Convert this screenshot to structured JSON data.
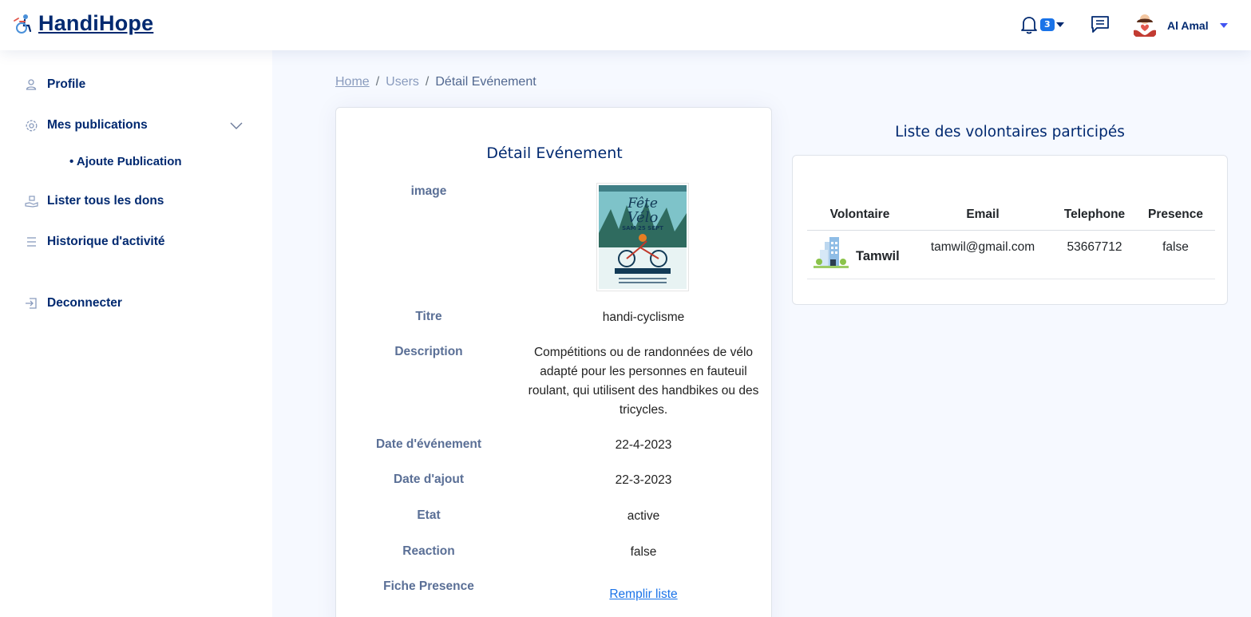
{
  "header": {
    "logo_text": "HandiHope",
    "notification_count": "3",
    "user_name": "Al Amal"
  },
  "sidebar": {
    "items": [
      {
        "label": "Profile",
        "icon": "person-icon"
      },
      {
        "label": "Mes publications",
        "icon": "gear-icon"
      },
      {
        "label": "Lister tous les dons",
        "icon": "donate-icon"
      },
      {
        "label": "Historique d'activité",
        "icon": "list-icon"
      },
      {
        "label": "Deconnecter",
        "icon": "logout-icon"
      }
    ],
    "sub_item": "• Ajoute Publication"
  },
  "breadcrumb": {
    "home": "Home",
    "users": "Users",
    "current": "Détail Evénement"
  },
  "detail": {
    "title": "Détail Evénement",
    "labels": {
      "image": "image",
      "titre": "Titre",
      "description": "Description",
      "date_evenement": "Date d'événement",
      "date_ajout": "Date d'ajout",
      "etat": "Etat",
      "reaction": "Reaction",
      "fiche_presence": "Fiche Presence"
    },
    "values": {
      "titre": "handi-cyclisme",
      "description": "Compétitions ou de randonnées de vélo adapté pour les personnes en fauteuil roulant, qui utilisent des handbikes ou des tricycles.",
      "date_evenement": "22-4-2023",
      "date_ajout": "22-3-2023",
      "etat": "active",
      "reaction": "false",
      "fiche_presence_link": "Remplir liste"
    },
    "poster": {
      "line1": "Fête",
      "line2": "Vélo",
      "line3": "SAM 25 SEPT"
    }
  },
  "volunteers": {
    "title": "Liste des volontaires participés",
    "columns": [
      "Volontaire",
      "Email",
      "Telephone",
      "Presence"
    ],
    "rows": [
      {
        "name": "Tamwil",
        "email": "tamwil@gmail.com",
        "telephone": "53667712",
        "presence": "false"
      }
    ]
  },
  "colors": {
    "primary": "#012970",
    "accent": "#1a73e8",
    "background": "#f6f9ff"
  }
}
